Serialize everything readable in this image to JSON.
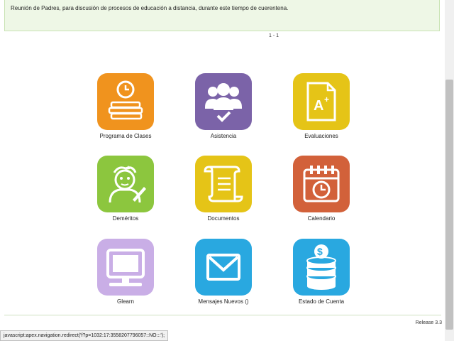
{
  "notice": {
    "text": "Reunión de Padres, para discusión de procesos de educación a distancia, durante este tiempo de cuerentena."
  },
  "pagination": {
    "label": "1 - 1"
  },
  "tiles": [
    {
      "label": "Programa de Clases",
      "color": "#f0931e",
      "icon": "books-clock-icon"
    },
    {
      "label": "Asistencia",
      "color": "#7b63a8",
      "icon": "group-check-icon"
    },
    {
      "label": "Evaluaciones",
      "color": "#e5c417",
      "icon": "grade-document-icon"
    },
    {
      "label": "Deméritos",
      "color": "#8cc63e",
      "icon": "student-writing-icon"
    },
    {
      "label": "Documentos",
      "color": "#e5c417",
      "icon": "scroll-icon"
    },
    {
      "label": "Calendario",
      "color": "#d2613a",
      "icon": "calendar-clock-icon"
    },
    {
      "label": "Glearn",
      "color": "#c9aee6",
      "icon": "monitor-icon"
    },
    {
      "label": "Mensajes Nuevos ()",
      "color": "#29a8e0",
      "icon": "envelope-icon"
    },
    {
      "label": "Estado de Cuenta",
      "color": "#29a8e0",
      "icon": "coins-dollar-icon"
    }
  ],
  "footer": {
    "release": "Release 3.3"
  },
  "status_bar": {
    "text": "javascript:apex.navigation.redirect('f?p=1032:17:3558207796057::NO:::');"
  }
}
